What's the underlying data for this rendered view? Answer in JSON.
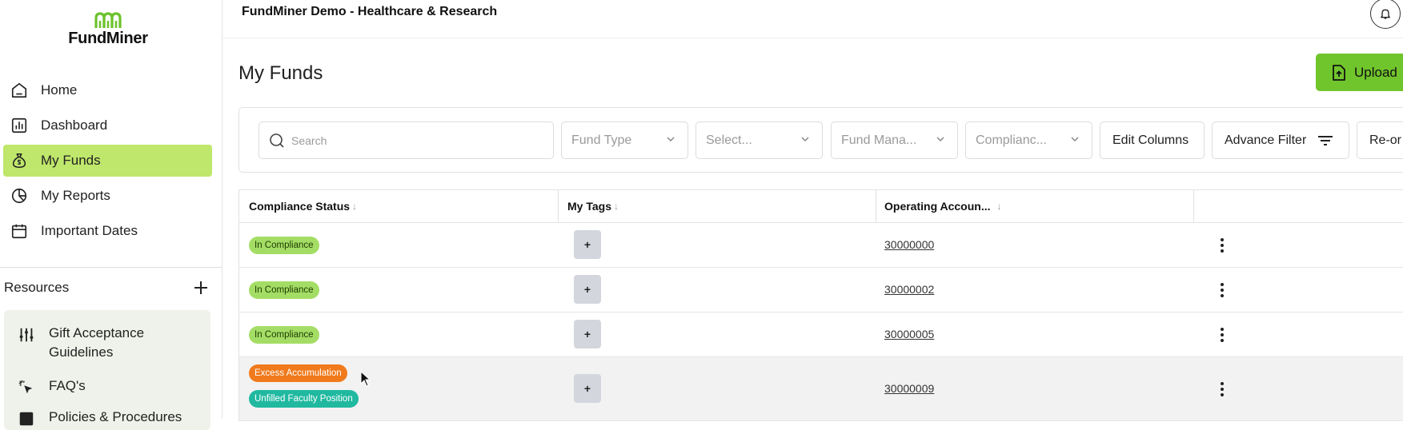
{
  "app": {
    "logo_text": "FundMiner",
    "org_title": "FundMiner Demo - Healthcare & Research"
  },
  "sidebar": {
    "items": [
      {
        "label": "Home",
        "icon": "home-icon",
        "active": false
      },
      {
        "label": "Dashboard",
        "icon": "bar-chart-icon",
        "active": false
      },
      {
        "label": "My Funds",
        "icon": "money-bag-icon",
        "active": true
      },
      {
        "label": "My Reports",
        "icon": "pie-chart-icon",
        "active": false
      },
      {
        "label": "Important Dates",
        "icon": "calendar-icon",
        "active": false
      }
    ],
    "resources_title": "Resources",
    "resources": [
      {
        "label": "Gift Acceptance Guidelines",
        "icon": "sliders-icon"
      },
      {
        "label": "FAQ's",
        "icon": "cursor-click-icon"
      },
      {
        "label": "Policies & Procedures",
        "icon": "document-icon"
      }
    ]
  },
  "page": {
    "title": "My Funds",
    "upload_label": "Upload"
  },
  "filters": {
    "search_placeholder": "Search",
    "fund_type": "Fund Type",
    "select": "Select...",
    "fund_manager": "Fund Mana...",
    "compliance": "Complianc...",
    "edit_columns": "Edit Columns",
    "advance_filter": "Advance Filter",
    "reorder": "Re-or"
  },
  "table": {
    "columns": [
      "Compliance Status",
      "My Tags",
      "Operating Accoun..."
    ],
    "rows": [
      {
        "statuses": [
          {
            "text": "In Compliance",
            "color": "green"
          }
        ],
        "tag_button": "+",
        "account": "30000000"
      },
      {
        "statuses": [
          {
            "text": "In Compliance",
            "color": "green"
          }
        ],
        "tag_button": "+",
        "account": "30000002"
      },
      {
        "statuses": [
          {
            "text": "In Compliance",
            "color": "green"
          }
        ],
        "tag_button": "+",
        "account": "30000005"
      },
      {
        "statuses": [
          {
            "text": "Excess Accumulation",
            "color": "orange"
          },
          {
            "text": "Unfilled Faculty Position",
            "color": "teal"
          }
        ],
        "tag_button": "+",
        "account": "30000009"
      }
    ]
  },
  "colors": {
    "accent_green": "#bfe76b",
    "upload_green": "#71c52c",
    "badge_green": "#a4dd65",
    "badge_orange": "#f07a1c",
    "badge_teal": "#20b9a0"
  }
}
